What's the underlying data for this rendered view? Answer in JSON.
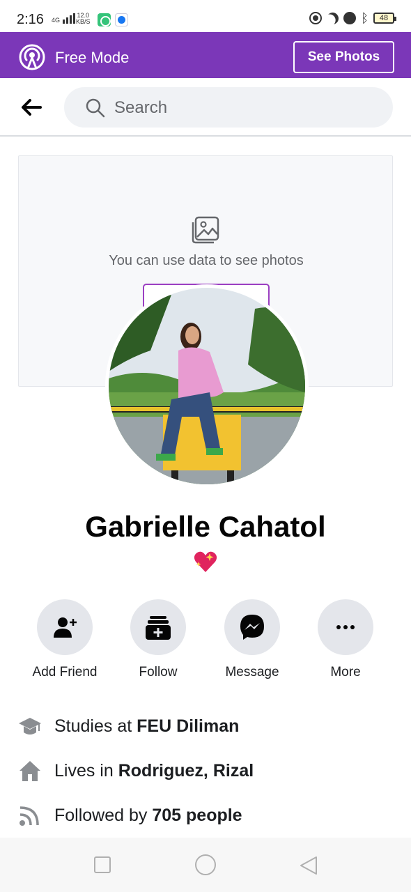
{
  "status_bar": {
    "time": "2:16",
    "network": "4G",
    "speed_value": "12.0",
    "speed_unit": "KB/S",
    "battery": "48",
    "icons": [
      "app-icon-green",
      "messenger-icon",
      "do-not-disturb-icon",
      "moon-icon",
      "alarm-icon",
      "bluetooth-icon",
      "battery-icon"
    ]
  },
  "free_mode": {
    "title": "Free Mode",
    "see_photos_label": "See Photos",
    "icon": "broadcast-icon"
  },
  "header": {
    "search_placeholder": "Search",
    "back_icon": "back-arrow-icon",
    "search_icon": "search-icon"
  },
  "cover": {
    "message": "You can use data to see photos",
    "icon": "photo-icon"
  },
  "profile": {
    "name": "Gabrielle Cahatol",
    "emoji": "sparkling-heart-icon"
  },
  "actions": [
    {
      "label": "Add Friend",
      "icon": "add-friend-icon"
    },
    {
      "label": "Follow",
      "icon": "follow-icon"
    },
    {
      "label": "Message",
      "icon": "messenger-icon"
    },
    {
      "label": "More",
      "icon": "more-icon"
    }
  ],
  "intro": [
    {
      "prefix": "Studies at ",
      "value": "FEU Diliman",
      "icon": "graduation-cap-icon"
    },
    {
      "prefix": "Lives in ",
      "value": "Rodriguez, Rizal",
      "icon": "home-icon"
    },
    {
      "prefix": "Followed by ",
      "value": "705 people",
      "icon": "rss-icon"
    }
  ],
  "colors": {
    "free_mode_bg": "#7b37b8",
    "action_bg": "#e4e6eb",
    "search_bg": "#f0f2f5"
  }
}
